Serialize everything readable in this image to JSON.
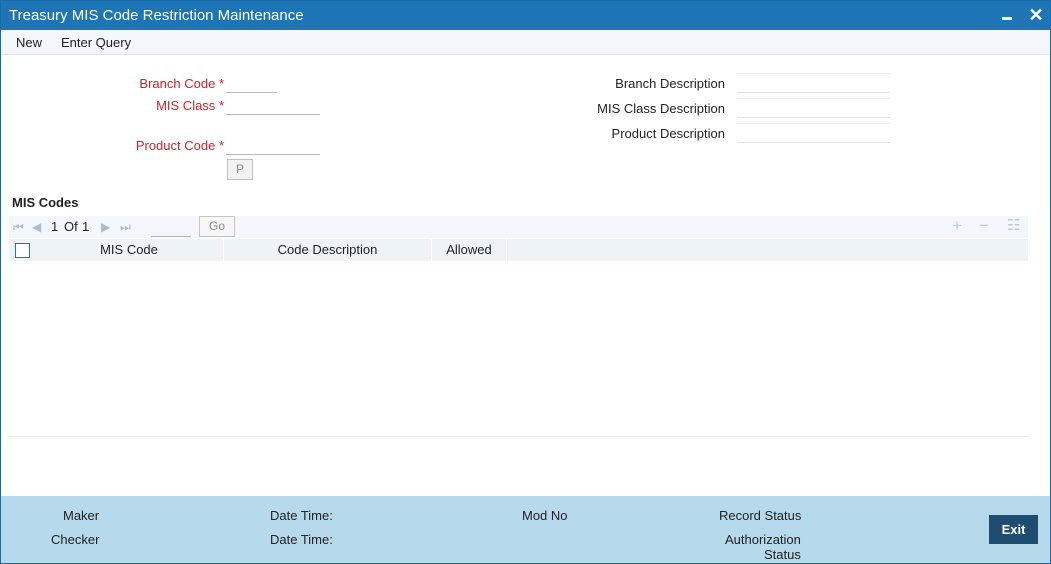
{
  "window": {
    "title": "Treasury MIS Code Restriction Maintenance",
    "minimize_icon": "minimize-icon",
    "close_icon": "close-icon"
  },
  "menu": {
    "new_label": "New",
    "enter_query_label": "Enter Query"
  },
  "form": {
    "branch_code_label": "Branch Code",
    "mis_class_label": "MIS Class",
    "product_code_label": "Product Code",
    "required_marker": "*",
    "branch_code_value": "",
    "mis_class_value": "",
    "product_code_value": "",
    "lov_button_label": "P",
    "branch_description_label": "Branch Description",
    "mis_class_description_label": "MIS Class Description",
    "product_description_label": "Product Description",
    "branch_description_value": "",
    "mis_class_description_value": "",
    "product_description_value": ""
  },
  "grid": {
    "section_title": "MIS Codes",
    "pagination": {
      "current_page": "1",
      "of_label": "Of",
      "total_pages": "1",
      "page_input_value": "",
      "go_label": "Go"
    },
    "toolbar_icons": [
      "first-page-icon",
      "previous-page-icon",
      "next-page-icon",
      "last-page-icon",
      "add-row-icon",
      "delete-row-icon",
      "single-view-icon"
    ],
    "columns": [
      "MIS Code",
      "Code Description",
      "Allowed"
    ],
    "rows": []
  },
  "footer": {
    "maker_label": "Maker",
    "checker_label": "Checker",
    "date_time_label": "Date Time:",
    "mod_no_label": "Mod No",
    "record_status_label": "Record Status",
    "authorization_status_line1": "Authorization",
    "authorization_status_line2": "Status",
    "exit_label": "Exit"
  },
  "colors": {
    "title_bar": "#1e75b5",
    "required_label": "#d4202a",
    "footer_bg": "#b6d9ec",
    "exit_button": "#1f4d72"
  }
}
